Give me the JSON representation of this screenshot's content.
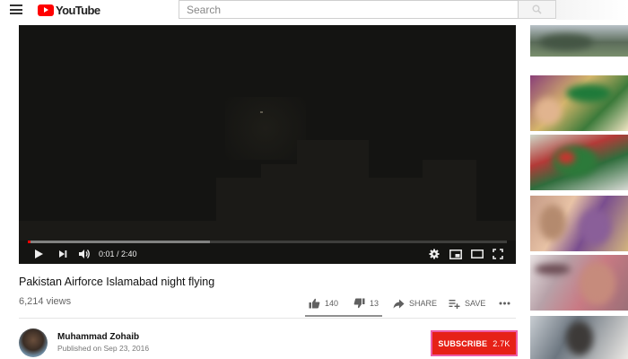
{
  "header": {
    "logo_text": "YouTube",
    "search_placeholder": "Search"
  },
  "player": {
    "time_display": "0:01 / 2:40",
    "played_fraction": 0.006,
    "buffered_fraction": 0.38
  },
  "video": {
    "title": "Pakistan Airforce Islamabad night flying",
    "views": "6,214 views",
    "likes": "140",
    "dislikes": "13",
    "share_label": "SHARE",
    "save_label": "SAVE"
  },
  "channel": {
    "name": "Muhammad Zohaib",
    "published": "Published on Sep 23, 2016",
    "subscribe_label": "SUBSCRIBE",
    "subscriber_count": "2.7K"
  },
  "colors": {
    "brand_red": "#ff0000",
    "subscribe_red": "#e62117",
    "subscribe_highlight": "#ec5ba7"
  }
}
